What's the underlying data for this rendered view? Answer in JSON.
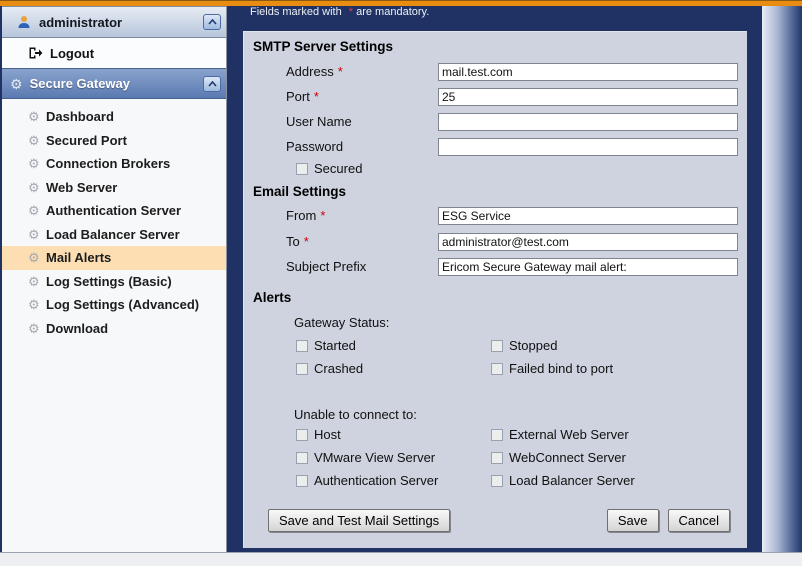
{
  "ui": {
    "required_marker": "*",
    "mandatory_prefix": "Fields marked with ",
    "mandatory_star": "*",
    "mandatory_suffix": " are mandatory."
  },
  "icons": {
    "gear": "⚙"
  },
  "colors": {
    "accent_orange": "#e88c12",
    "navy_background": "#1f3263",
    "panel_background": "#ced3df",
    "active_item_highlight": "#fcdeb2"
  },
  "sidebar": {
    "user": {
      "label": "administrator"
    },
    "logout_label": "Logout",
    "group_label": "Secure Gateway",
    "items": [
      {
        "label": "Dashboard"
      },
      {
        "label": "Secured Port"
      },
      {
        "label": "Connection Brokers"
      },
      {
        "label": "Web Server"
      },
      {
        "label": "Authentication Server"
      },
      {
        "label": "Load Balancer Server"
      },
      {
        "label": "Mail Alerts",
        "active": true
      },
      {
        "label": "Log Settings (Basic)"
      },
      {
        "label": "Log Settings (Advanced)"
      },
      {
        "label": "Download"
      }
    ]
  },
  "main": {
    "smtp": {
      "heading": "SMTP Server Settings",
      "address_label": "Address",
      "address_value": "mail.test.com",
      "port_label": "Port",
      "port_value": "25",
      "username_label": "User Name",
      "username_value": "",
      "password_label": "Password",
      "password_value": "",
      "secured_label": "Secured"
    },
    "email": {
      "heading": "Email Settings",
      "from_label": "From",
      "from_value": "ESG Service",
      "to_label": "To",
      "to_value": "administrator@test.com",
      "subject_label": "Subject Prefix",
      "subject_value": "Ericom Secure Gateway mail alert:"
    },
    "alerts": {
      "heading": "Alerts",
      "gateway_label": "Gateway Status:",
      "gateway_items": [
        "Started",
        "Stopped",
        "Crashed",
        "Failed bind to port"
      ],
      "unable_label": "Unable to connect to:",
      "unable_items": [
        "Host",
        "External Web Server",
        "VMware View Server",
        "WebConnect Server",
        "Authentication Server",
        "Load Balancer Server"
      ]
    },
    "buttons": {
      "save_test": "Save and Test Mail Settings",
      "save": "Save",
      "cancel": "Cancel"
    }
  }
}
